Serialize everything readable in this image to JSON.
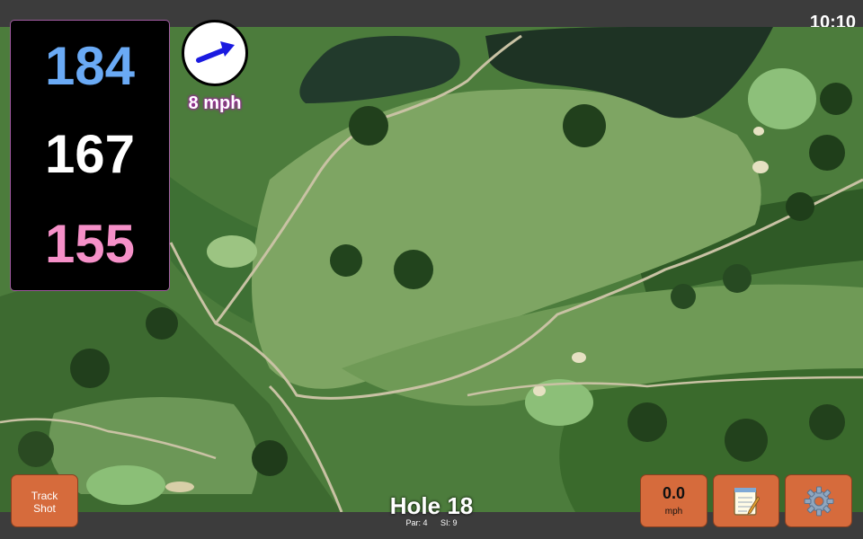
{
  "status_bar": {
    "time": "10:10"
  },
  "yardage": {
    "back": "184",
    "middle": "167",
    "front": "155"
  },
  "wind": {
    "speed_label": "8 mph",
    "direction_icon": "arrow-up-right-icon"
  },
  "hole": {
    "title": "Hole 18",
    "par_label": "Par: 4",
    "si_label": "SI: 9"
  },
  "buttons": {
    "track_shot_line1": "Track",
    "track_shot_line2": "Shot",
    "speed_value": "0.0",
    "speed_unit": "mph",
    "notes_icon": "notepad-icon",
    "settings_icon": "gear-icon"
  },
  "colors": {
    "back_yardage": "#6aaaf5",
    "middle_yardage": "#ffffff",
    "front_yardage": "#f590c8",
    "button_bg": "#d66b3c",
    "wind_arrow": "#1a1ae0"
  }
}
